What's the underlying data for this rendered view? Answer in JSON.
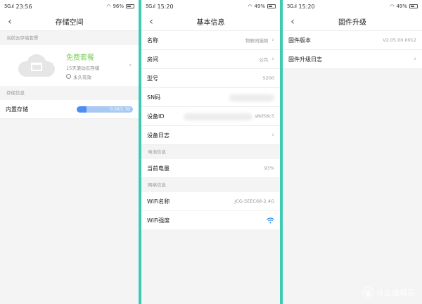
{
  "screens": [
    {
      "status": {
        "time": "23:56",
        "battery": "96%"
      },
      "title": "存储空间",
      "section_cloud": "当前云存储套餐",
      "package": {
        "name": "免费套餐",
        "desc": "15天滚动云存储",
        "validity": "永久有效"
      },
      "section_storage": "存储信息",
      "storage": {
        "label": "内置存储",
        "usage_text": "0.30/1.70",
        "usage_fraction": 0.18
      }
    },
    {
      "status": {
        "time": "15:20",
        "battery": "49%"
      },
      "title": "基本信息",
      "rows_top": [
        {
          "label": "名称",
          "value": "物联网猫眼"
        },
        {
          "label": "房间",
          "value": "公共"
        },
        {
          "label": "型号",
          "value": "S200"
        },
        {
          "label": "SN码",
          "value": ""
        },
        {
          "label": "设备ID",
          "value": "s8d58c5"
        },
        {
          "label": "设备日志",
          "value": ""
        }
      ],
      "section_battery": "电池信息",
      "battery_row": {
        "label": "当前电量",
        "value": "93%"
      },
      "section_network": "网络信息",
      "wifi_name": {
        "label": "WiFi名称",
        "value": "JCG-5EEC68-2.4G"
      },
      "wifi_strength": {
        "label": "WiFi强度"
      }
    },
    {
      "status": {
        "time": "15:20",
        "battery": "49%"
      },
      "title": "固件升级",
      "firmware_version": {
        "label": "固件版本",
        "value": "V2.05.00.0012"
      },
      "firmware_log": {
        "label": "固件升级日志"
      }
    }
  ],
  "watermark": {
    "text": "什么值得买",
    "icon": "zhi-logo-icon"
  },
  "colors": {
    "accent_green": "#7bcc58",
    "bar_fill": "#4e8df2",
    "bar_bg": "#a9c9f3",
    "wifi": "#2f8ff0"
  }
}
